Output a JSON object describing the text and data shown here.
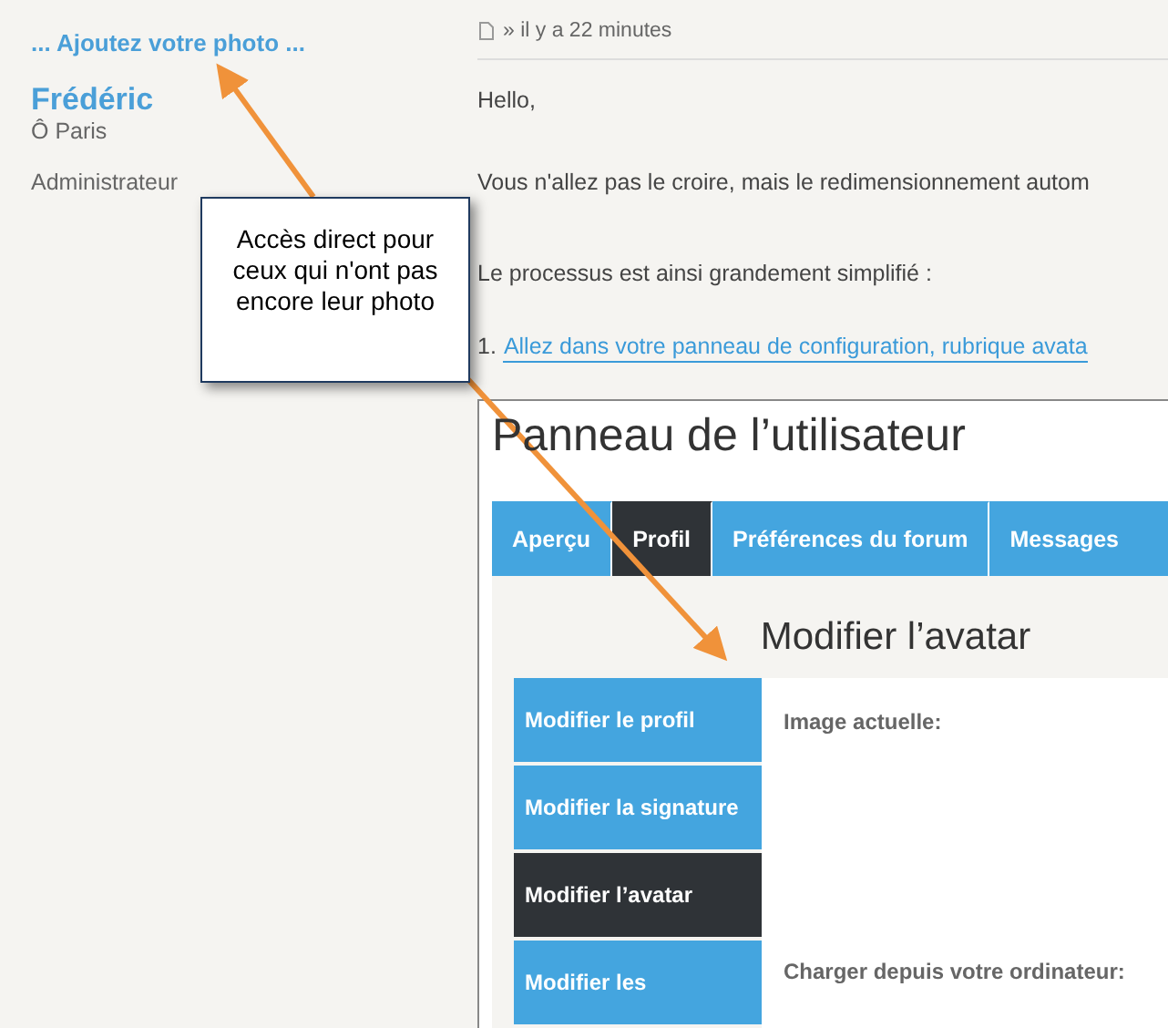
{
  "profile": {
    "add_photo_link": "... Ajoutez votre photo ...",
    "name": "Frédéric",
    "location": "Ô Paris",
    "rank": "Administrateur"
  },
  "post": {
    "meta": "» il y a 22 minutes",
    "paragraphs": [
      {
        "kind": "text",
        "text": "Hello,"
      },
      {
        "kind": "text",
        "text": "Vous n'allez pas le croire, mais le redimensionnement autom"
      },
      {
        "kind": "text",
        "text": "Le processus est ainsi grandement simplifié :"
      },
      {
        "kind": "link",
        "number": "1.",
        "text": "Allez dans votre panneau de configuration, rubrique avata"
      }
    ]
  },
  "embedded_panel": {
    "title": "Panneau de l’utilisateur",
    "tabs": [
      {
        "label": "Aperçu",
        "selected": false
      },
      {
        "label": "Profil",
        "selected": true
      },
      {
        "label": "Préférences du forum",
        "selected": false
      },
      {
        "label": "Messages",
        "selected": false
      }
    ],
    "heading": "Modifier l’avatar",
    "menu": [
      {
        "label": "Modifier le profil",
        "selected": false
      },
      {
        "label": "Modifier la signature",
        "selected": false
      },
      {
        "label": "Modifier l’avatar",
        "selected": true
      },
      {
        "label": "Modifier les",
        "selected": false
      }
    ],
    "fields": [
      "Image actuelle:",
      "Charger depuis votre ordinateur:"
    ]
  },
  "callout": {
    "text": "Accès direct pour ceux qui n'ont pas encore leur photo"
  }
}
